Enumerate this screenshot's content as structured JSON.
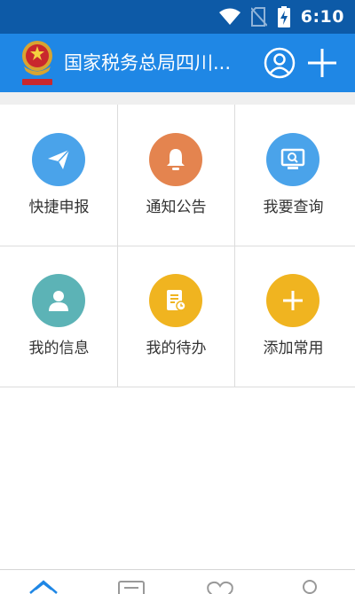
{
  "status_bar": {
    "time": "6:10"
  },
  "app_bar": {
    "title": "国家税务总局四川..."
  },
  "grid": {
    "tiles": [
      {
        "label": "快捷申报",
        "color": "#4aa3ea",
        "icon": "paper-plane-icon"
      },
      {
        "label": "通知公告",
        "color": "#e4844f",
        "icon": "bell-icon"
      },
      {
        "label": "我要查询",
        "color": "#4aa3ea",
        "icon": "monitor-search-icon"
      },
      {
        "label": "我的信息",
        "color": "#5cb3b6",
        "icon": "person-icon"
      },
      {
        "label": "我的待办",
        "color": "#f0b420",
        "icon": "document-clock-icon"
      },
      {
        "label": "添加常用",
        "color": "#f0b420",
        "icon": "plus-icon"
      }
    ]
  },
  "bottom_nav": {
    "icons": [
      "home-icon",
      "list-icon",
      "heart-icon",
      "user-icon"
    ]
  },
  "colors": {
    "status_bar": "#0d5aa7",
    "app_bar": "#1f87e5"
  }
}
